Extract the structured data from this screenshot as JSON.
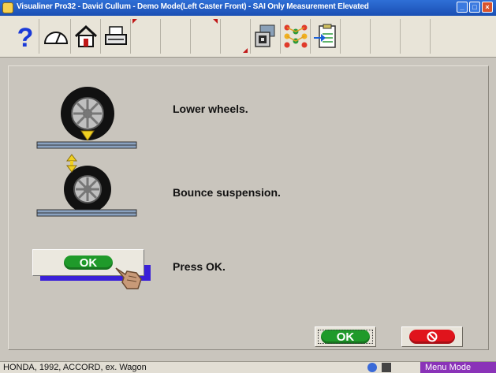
{
  "window": {
    "title": "Visualiner Pro32 - David Cullum - Demo Mode(Left Caster Front)  -  SAI Only Measurement Elevated"
  },
  "toolbar": {
    "icons": [
      "help-icon",
      "gauge-icon",
      "home-icon",
      "printer-icon",
      "vehicle-measure-icon",
      "alignment-pattern-icon",
      "clipboard-arrow-icon"
    ]
  },
  "instructions": {
    "step1": "Lower wheels.",
    "step2": "Bounce suspension.",
    "step3": "Press OK.",
    "ok_graphic_label": "OK"
  },
  "buttons": {
    "ok_label": "OK",
    "cancel_icon": "cancel-icon"
  },
  "status": {
    "vehicle": "HONDA, 1992, ACCORD, ex. Wagon",
    "mode": "Menu Mode"
  },
  "colors": {
    "title_bar": "#1a4fb4",
    "ok_green": "#1f9a2a",
    "cancel_red": "#e0141c",
    "mode_purple": "#8a33b8"
  }
}
